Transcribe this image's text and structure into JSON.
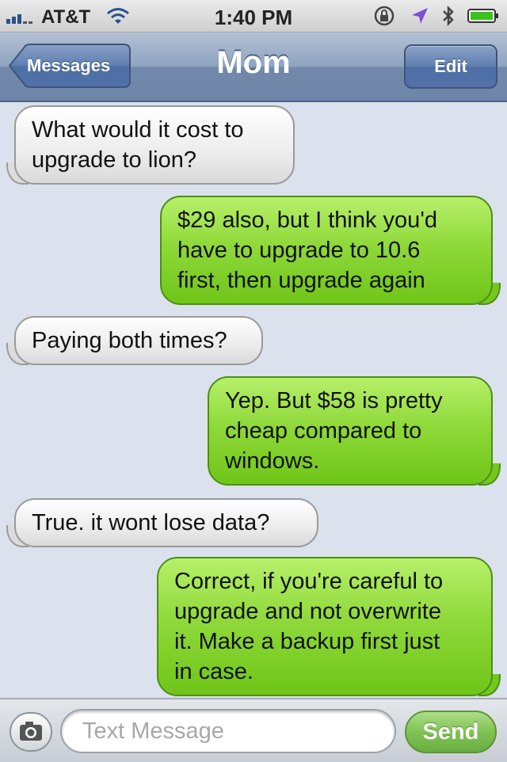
{
  "status_bar": {
    "carrier": "AT&T",
    "time": "1:40 PM"
  },
  "nav": {
    "back_label": "Messages",
    "title": "Mom",
    "edit_label": "Edit"
  },
  "messages": [
    {
      "direction": "incoming",
      "lines": [
        "What would it cost to",
        "upgrade to lion?"
      ]
    },
    {
      "direction": "outgoing",
      "lines": [
        "$29 also, but I think you'd",
        "have to upgrade to 10.6",
        "first, then upgrade again"
      ]
    },
    {
      "direction": "incoming",
      "lines": [
        "Paying both times?"
      ]
    },
    {
      "direction": "outgoing",
      "lines": [
        "Yep. But $58 is pretty",
        "cheap compared to",
        "windows."
      ]
    },
    {
      "direction": "incoming",
      "lines": [
        "True.  it wont lose data?"
      ]
    },
    {
      "direction": "outgoing",
      "lines": [
        "Correct, if you're careful to",
        "upgrade and not overwrite",
        "it. Make a backup first just",
        "in case."
      ]
    }
  ],
  "input_bar": {
    "placeholder": "Text Message",
    "value": "",
    "send_label": "Send"
  },
  "colors": {
    "outgoing_bubble": "#8fd93a",
    "incoming_bubble": "#ececec",
    "background": "#dbe2ed",
    "nav_bar": "#7389ab"
  },
  "icons": [
    "signal-bars-icon",
    "wifi-icon",
    "rotation-lock-icon",
    "location-arrow-icon",
    "bluetooth-icon",
    "battery-icon",
    "back-chevron-icon",
    "camera-icon"
  ]
}
